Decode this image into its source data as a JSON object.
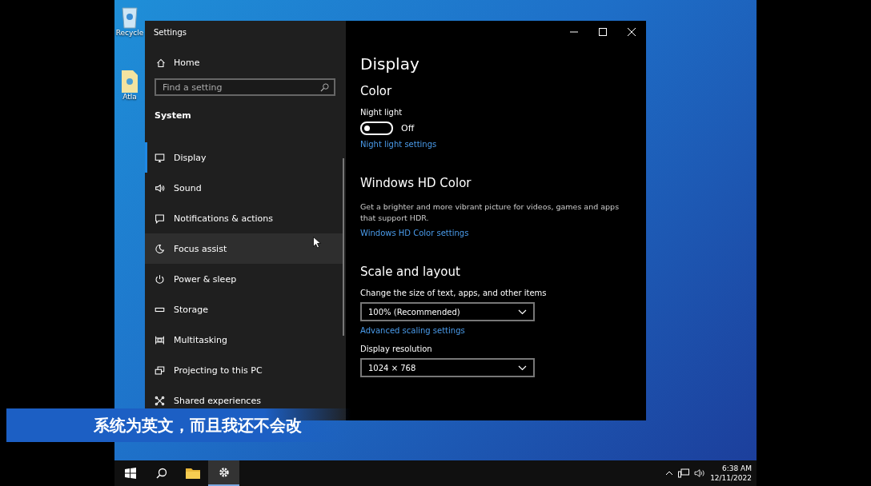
{
  "desktop_icons": [
    {
      "label": "Recycle"
    },
    {
      "label": "Atla"
    }
  ],
  "window": {
    "title": "Settings",
    "home": "Home",
    "search": {
      "placeholder": "Find a setting"
    },
    "section": "System",
    "nav": [
      {
        "label": "Display",
        "selected": true,
        "hovered": false
      },
      {
        "label": "Sound",
        "selected": false,
        "hovered": false
      },
      {
        "label": "Notifications & actions",
        "selected": false,
        "hovered": false
      },
      {
        "label": "Focus assist",
        "selected": false,
        "hovered": true
      },
      {
        "label": "Power & sleep",
        "selected": false,
        "hovered": false
      },
      {
        "label": "Storage",
        "selected": false,
        "hovered": false
      },
      {
        "label": "Multitasking",
        "selected": false,
        "hovered": false
      },
      {
        "label": "Projecting to this PC",
        "selected": false,
        "hovered": false
      },
      {
        "label": "Shared experiences",
        "selected": false,
        "hovered": false
      }
    ],
    "page_title": "Display",
    "content": [
      {
        "kind": "heading",
        "text": "Color"
      },
      {
        "kind": "label",
        "text": "Night light"
      },
      {
        "kind": "toggle",
        "text": "Off",
        "on": false
      },
      {
        "kind": "link",
        "text": "Night light settings"
      },
      {
        "kind": "heading",
        "text": "Windows HD Color"
      },
      {
        "kind": "paragraph",
        "text": "Get a brighter and more vibrant picture for videos, games and apps that support HDR."
      },
      {
        "kind": "link",
        "text": "Windows HD Color settings"
      },
      {
        "kind": "heading",
        "text": "Scale and layout"
      },
      {
        "kind": "label",
        "text": "Change the size of text, apps, and other items"
      },
      {
        "kind": "dropdown",
        "text": "100% (Recommended)"
      },
      {
        "kind": "link",
        "text": "Advanced scaling settings"
      },
      {
        "kind": "label",
        "text": "Display resolution"
      },
      {
        "kind": "dropdown",
        "text": "1024 × 768"
      }
    ]
  },
  "taskbar": {
    "buttons": [
      {
        "selected": false
      },
      {
        "selected": false
      },
      {
        "selected": false
      },
      {
        "selected": true
      }
    ],
    "time": "6:38 AM",
    "date": "12/11/2022"
  },
  "caption": "系统为英文，而且我还不会改"
}
